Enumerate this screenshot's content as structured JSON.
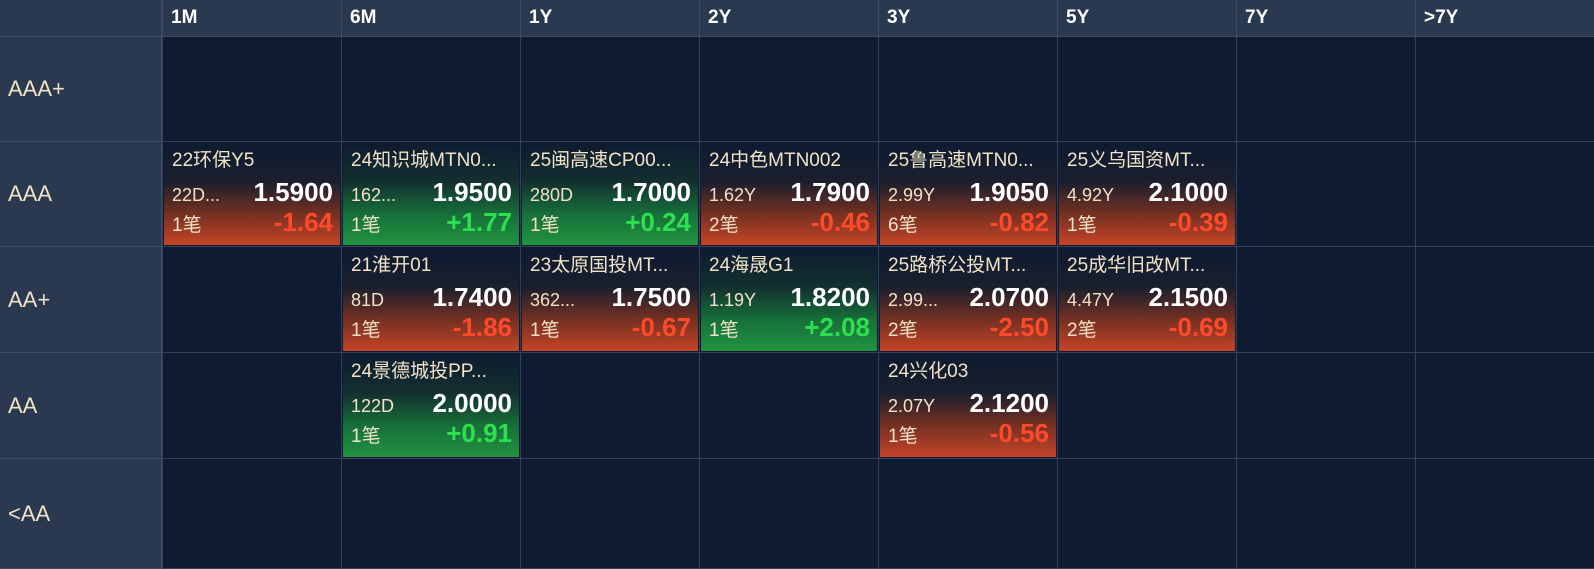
{
  "columns": [
    "1M",
    "6M",
    "1Y",
    "2Y",
    "3Y",
    "5Y",
    "7Y",
    ">7Y"
  ],
  "rows": [
    "AAA+",
    "AAA",
    "AA+",
    "AA",
    "<AA"
  ],
  "colors": {
    "background": "#0e1b30",
    "header": "#2a3850",
    "negative": "#ff4a2a",
    "positive": "#2ee04f",
    "label": "#f2e3c8"
  },
  "cells": {
    "r1c0": {
      "name": "22环保Y5",
      "term": "22D...",
      "price": "1.5900",
      "count": "1笔",
      "change": "-1.64",
      "dir": "down"
    },
    "r1c1": {
      "name": "24知识城MTN0...",
      "term": "162...",
      "price": "1.9500",
      "count": "1笔",
      "change": "+1.77",
      "dir": "up"
    },
    "r1c2": {
      "name": "25闽高速CP00...",
      "term": "280D",
      "price": "1.7000",
      "count": "1笔",
      "change": "+0.24",
      "dir": "up"
    },
    "r1c3": {
      "name": "24中色MTN002",
      "term": "1.62Y",
      "price": "1.7900",
      "count": "2笔",
      "change": "-0.46",
      "dir": "down"
    },
    "r1c4": {
      "name": "25鲁高速MTN0...",
      "term": "2.99Y",
      "price": "1.9050",
      "count": "6笔",
      "change": "-0.82",
      "dir": "down"
    },
    "r1c5": {
      "name": "25义乌国资MT...",
      "term": "4.92Y",
      "price": "2.1000",
      "count": "1笔",
      "change": "-0.39",
      "dir": "down"
    },
    "r2c1": {
      "name": "21淮开01",
      "term": "81D",
      "price": "1.7400",
      "count": "1笔",
      "change": "-1.86",
      "dir": "down"
    },
    "r2c2": {
      "name": "23太原国投MT...",
      "term": "362...",
      "price": "1.7500",
      "count": "1笔",
      "change": "-0.67",
      "dir": "down"
    },
    "r2c3": {
      "name": "24海晟G1",
      "term": "1.19Y",
      "price": "1.8200",
      "count": "1笔",
      "change": "+2.08",
      "dir": "up"
    },
    "r2c4": {
      "name": "25路桥公投MT...",
      "term": "2.99...",
      "price": "2.0700",
      "count": "2笔",
      "change": "-2.50",
      "dir": "down"
    },
    "r2c5": {
      "name": "25成华旧改MT...",
      "term": "4.47Y",
      "price": "2.1500",
      "count": "2笔",
      "change": "-0.69",
      "dir": "down"
    },
    "r3c1": {
      "name": "24景德城投PP...",
      "term": "122D",
      "price": "2.0000",
      "count": "1笔",
      "change": "+0.91",
      "dir": "up"
    },
    "r3c4": {
      "name": "24兴化03",
      "term": "2.07Y",
      "price": "2.1200",
      "count": "1笔",
      "change": "-0.56",
      "dir": "down"
    }
  }
}
